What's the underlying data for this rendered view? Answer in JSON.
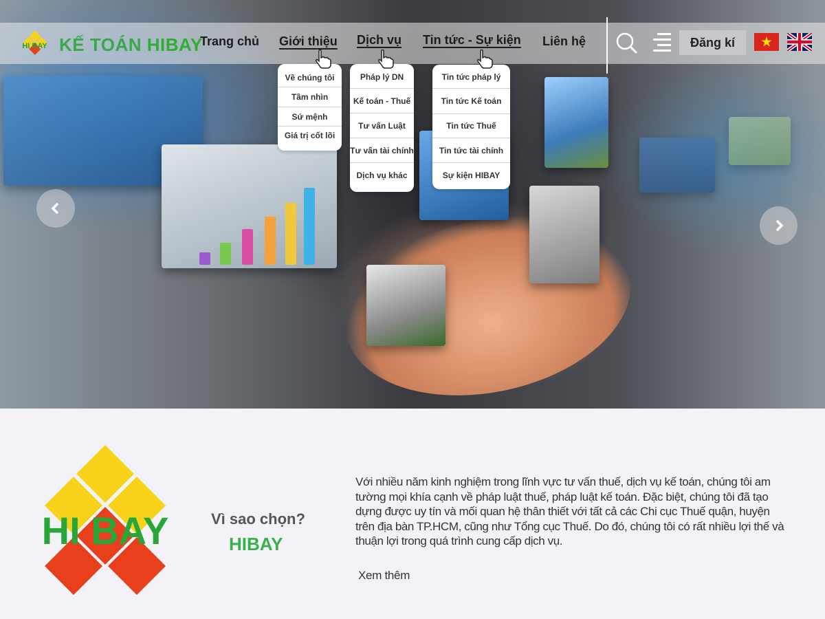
{
  "header": {
    "brand_prefix": "KẾ TOÁN",
    "brand_name": "HIBAY",
    "logo_text": "HI BAY",
    "nav": {
      "home": "Trang chủ",
      "about": "Giới thiệu",
      "services": "Dịch vụ",
      "news": "Tin tức - Sự kiện",
      "contact": "Liên hệ"
    },
    "register_label": "Đăng kí",
    "search_icon": "search-icon",
    "menu_icon": "hamburger-menu-icon",
    "languages": [
      "vi",
      "en"
    ]
  },
  "dropdowns": {
    "about": [
      "Về chúng tôi",
      "Tầm nhìn",
      "Sứ mệnh",
      "Giá trị cốt lõi"
    ],
    "services": [
      "Pháp lý DN",
      "Kế toán - Thuế",
      "Tư vấn Luật",
      "Tư vấn tài chính",
      "Dịch vụ khác"
    ],
    "news": [
      "Tin tức pháp lý",
      "Tin tức Kế toán",
      "Tin tức Thuế",
      "Tin tức tài chính",
      "Sự kiện HIBAY"
    ]
  },
  "slider": {
    "prev_icon": "chevron-left-icon",
    "next_icon": "chevron-right-icon"
  },
  "why": {
    "logo_text": "HI BAY",
    "heading": "Vì sao chọn?",
    "brand": "HIBAY",
    "description": "Với nhiều năm kinh nghiệm trong lĩnh vực tư vấn thuế, dịch vụ kế toán, chúng tôi am tường mọi khía cạnh về pháp luật thuế, pháp luật kế toán. Đặc biệt, chúng tôi đã tạo dựng được uy tín và mối quan hệ thân thiết với tất cả các Chi cục Thuế quận, huyện trên địa bàn TP.HCM, cũng như Tổng cục Thuế. Do đó, chúng tôi có rất nhiều lợi thế và thuận lợi trong quá trình cung cấp dịch vụ.",
    "more_label": "Xem thêm"
  },
  "colors": {
    "brand_green": "#39b04a",
    "logo_yellow": "#f7d21a",
    "logo_red": "#e8401c",
    "background": "#f3f3f7"
  }
}
